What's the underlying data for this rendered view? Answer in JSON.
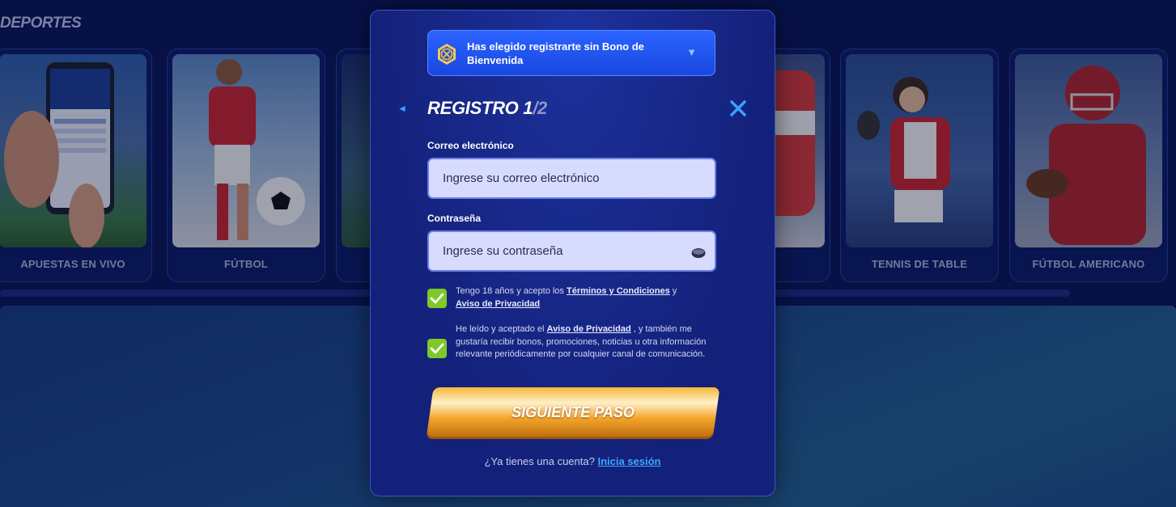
{
  "background": {
    "section_title": "DEPORTES",
    "cards": [
      {
        "label": "APUESTAS EN VIVO",
        "icon": "phone-betting-image"
      },
      {
        "label": "FÚTBOL",
        "icon": "soccer-player-image"
      },
      {
        "label": "",
        "icon": "stadium-image"
      },
      {
        "label": "",
        "icon": "hockey-player-image"
      },
      {
        "label": "TENNIS DE TABLE",
        "icon": "table-tennis-player-image"
      },
      {
        "label": "FÚTBOL AMERICANO",
        "icon": "american-football-player-image"
      }
    ]
  },
  "modal": {
    "bonus_selector": {
      "text": "Has elegido registrarte sin Bono de Bienvenida",
      "icon": "no-bonus-icon",
      "caret": "▼"
    },
    "back_glyph": "◄",
    "title": "REGISTRO 1",
    "title_step": "/2",
    "email": {
      "label": "Correo electrónico",
      "placeholder": "Ingrese su correo electrónico",
      "value": ""
    },
    "password": {
      "label": "Contraseña",
      "placeholder": "Ingrese su contraseña",
      "value": ""
    },
    "terms": {
      "checked": true,
      "text_1": "Tengo 18 años y acepto los ",
      "link_1": "Términos y Condiciones",
      "text_2": " y ",
      "link_2": "Aviso de Privacidad"
    },
    "marketing": {
      "checked": true,
      "text_1": "He leído y aceptado el ",
      "link_1": "Aviso de Privacidad",
      "text_2": " , y también me gustaría recibir bonos, promociones, noticias u otra información relevante periódicamente por cualquier canal de comunicación."
    },
    "next_button": "SIGUIENTE PASO",
    "login_prompt": "¿Ya tienes una cuenta? ",
    "login_link": "Inicia sesión"
  },
  "colors": {
    "accent": "#3ba0ff",
    "checkbox": "#7fc82a",
    "button_gold": "#f4a52a",
    "modal_bg": "#14217a"
  }
}
